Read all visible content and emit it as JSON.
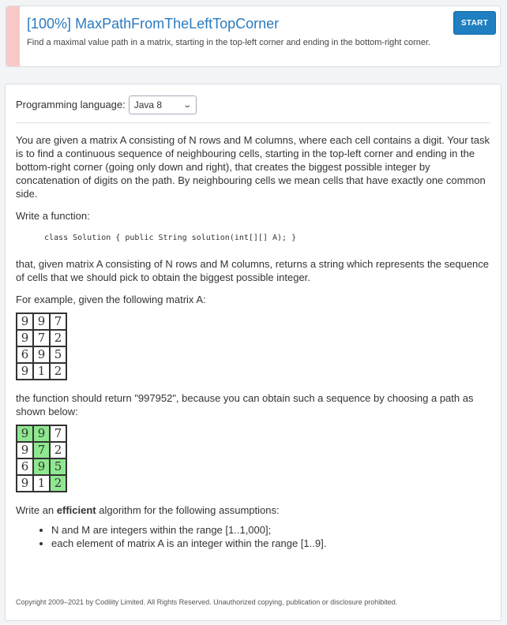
{
  "header": {
    "score": "[100%]",
    "title": "MaxPathFromTheLeftTopCorner",
    "subtitle": "Find a maximal value path in a matrix, starting in the top-left corner and ending in the bottom-right corner.",
    "start_label": "START"
  },
  "language": {
    "label": "Programming language:",
    "selected": "Java 8"
  },
  "body": {
    "p1": "You are given a matrix A consisting of N rows and M columns, where each cell contains a digit. Your task is to find a continuous sequence of neighbouring cells, starting in the top-left corner and ending in the bottom-right corner (going only down and right), that creates the biggest possible integer by concatenation of digits on the path. By neighbouring cells we mean cells that have exactly one common side.",
    "p2": "Write a function:",
    "code": "class Solution { public String solution(int[][] A); }",
    "p3": "that, given matrix A consisting of N rows and M columns, returns a string which represents the sequence of cells that we should pick to obtain the biggest possible integer.",
    "p4": "For example, given the following matrix A:",
    "p5": "the function should return \"997952\", because you can obtain such a sequence by choosing a path as shown below:",
    "p6_pre": "Write an ",
    "p6_strong": "efficient",
    "p6_post": " algorithm for the following assumptions:",
    "assumption1": "N and M are integers within the range [1..1,000];",
    "assumption2": "each element of matrix A is an integer within the range [1..9]."
  },
  "matrix": [
    [
      "9",
      "9",
      "7"
    ],
    [
      "9",
      "7",
      "2"
    ],
    [
      "6",
      "9",
      "5"
    ],
    [
      "9",
      "1",
      "2"
    ]
  ],
  "path_highlight": [
    [
      true,
      true,
      false
    ],
    [
      false,
      true,
      false
    ],
    [
      false,
      true,
      true
    ],
    [
      false,
      false,
      true
    ]
  ],
  "highlight_color": "#8fe88f",
  "copyright": "Copyright 2009–2021 by Codility Limited. All Rights Reserved. Unauthorized copying, publication or disclosure prohibited."
}
